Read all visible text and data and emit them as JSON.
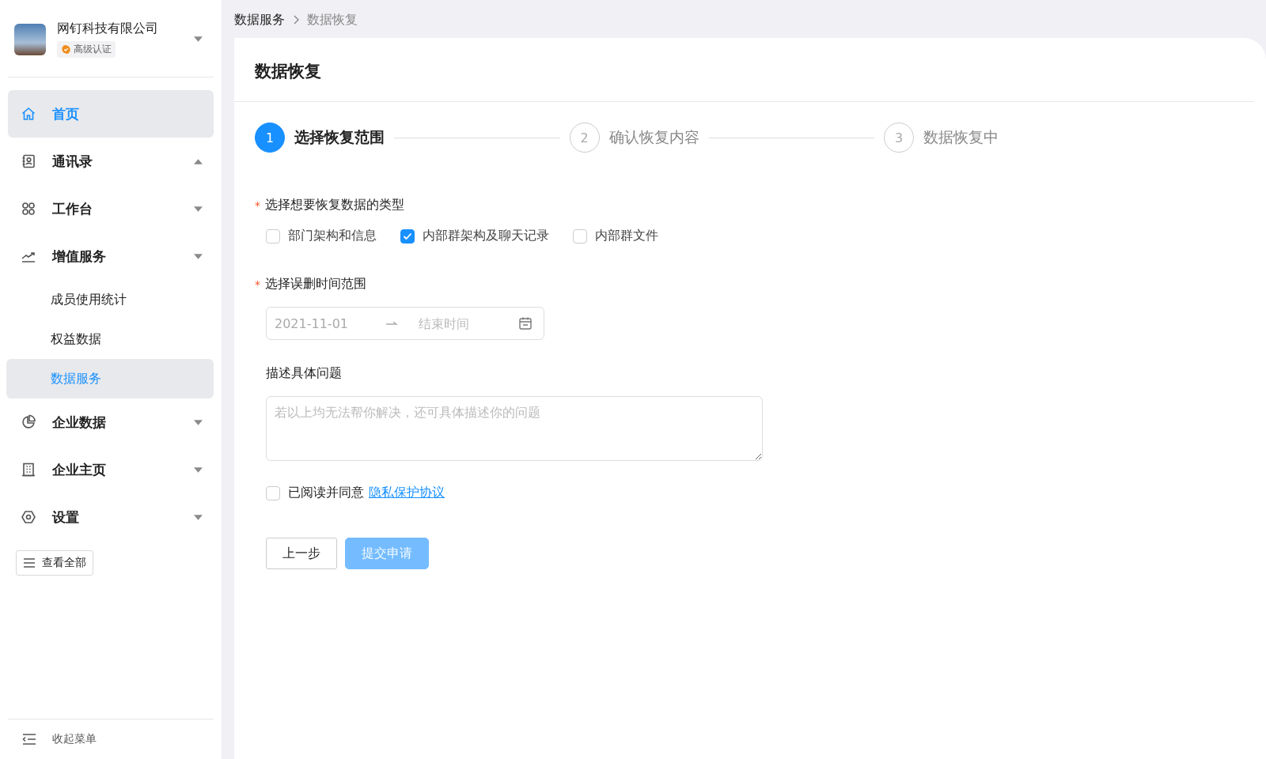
{
  "company": {
    "name": "网钉科技有限公司",
    "badge": "高级认证"
  },
  "nav": [
    {
      "label": "首页",
      "selected": true
    },
    {
      "label": "通讯录",
      "selected": false,
      "expanded": true
    },
    {
      "label": "工作台",
      "selected": false,
      "expanded": false
    },
    {
      "label": "增值服务",
      "selected": false,
      "expanded": false,
      "children": [
        {
          "label": "成员使用统计",
          "selected": false
        },
        {
          "label": "权益数据",
          "selected": false
        },
        {
          "label": "数据服务",
          "selected": true
        }
      ]
    },
    {
      "label": "企业数据",
      "selected": false,
      "expanded": false
    },
    {
      "label": "企业主页",
      "selected": false,
      "expanded": false
    },
    {
      "label": "设置",
      "selected": false,
      "expanded": false
    }
  ],
  "view_all": "查看全部",
  "collapse": "收起菜单",
  "breadcrumb": [
    "数据服务",
    "数据恢复"
  ],
  "page_title": "数据恢复",
  "steps": [
    {
      "number": "1",
      "label": "选择恢复范围",
      "selected": true
    },
    {
      "number": "2",
      "label": "确认恢复内容",
      "selected": false
    },
    {
      "number": "3",
      "label": "数据恢复中",
      "selected": false
    }
  ],
  "form": {
    "type_required": "*",
    "type_label": "选择想要恢复数据的类型",
    "types": [
      {
        "label": "部门架构和信息",
        "checked": false
      },
      {
        "label": "内部群架构及聊天记录",
        "checked": true
      },
      {
        "label": "内部群文件",
        "checked": false
      }
    ],
    "time_required": "*",
    "time_label": "选择误删时间范围",
    "start_date": "2021-11-01",
    "end_placeholder": "结束时间",
    "desc_label": "描述具体问题",
    "desc_placeholder": "若以上均无法帮你解决，还可具体描述你的问题",
    "agree": {
      "checked": false,
      "text": "已阅读并同意",
      "link": "隐私保护协议"
    },
    "back": "上一步",
    "submit": {
      "label": "提交申请",
      "disabled": true
    }
  }
}
